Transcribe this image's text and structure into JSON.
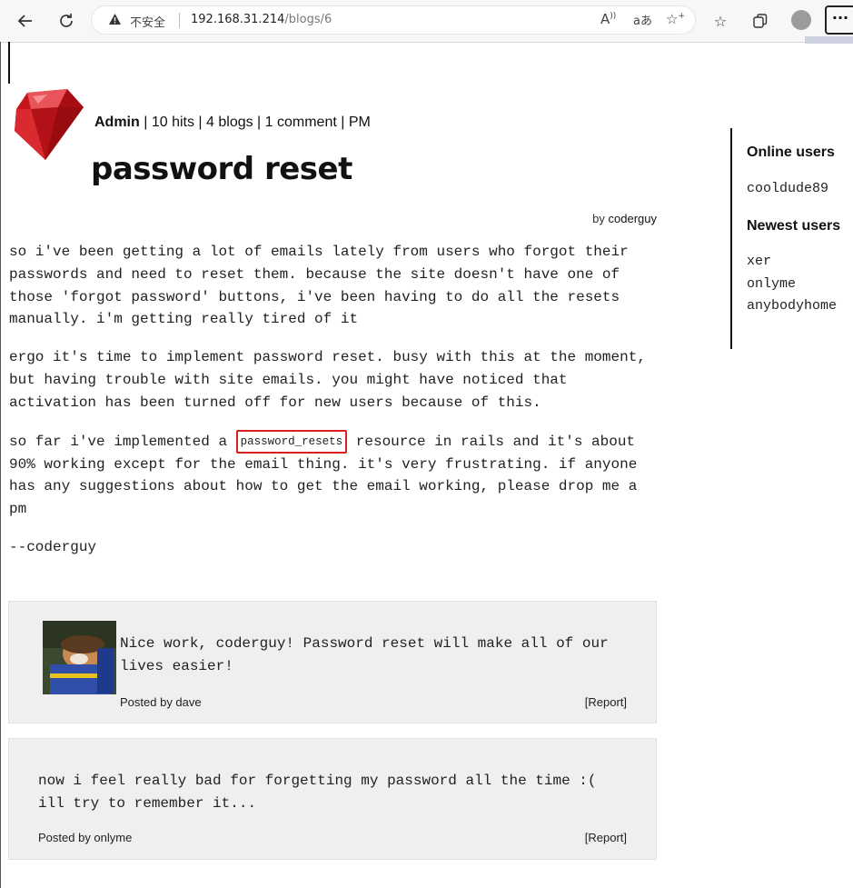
{
  "browser": {
    "security_label": "不安全",
    "url_host": "192.168.31.214",
    "url_path": "/blogs/6",
    "menu_label": "···"
  },
  "post": {
    "author_name": "Admin",
    "stats": " | 10 hits | 4 blogs | 1 comment | PM",
    "title": "password reset",
    "by_prefix": "by",
    "by_author": "coderguy",
    "para1": "so i've been getting a lot of emails lately from users who forgot their passwords and need to reset them. because the site doesn't have one of those 'forgot password' buttons, i've been having to do all the resets manually. i'm getting really tired of it",
    "para2": "ergo it's time to implement password reset. busy with this at the moment, but having trouble with site emails. you might have noticed that activation has been turned off for new users because of this.",
    "para3_before": "so far i've implemented a ",
    "para3_code": "password_resets",
    "para3_after": " resource in rails and it's about 90% working except for the email thing. it's very frustrating. if anyone has any suggestions about how to get the email working, please drop me a pm",
    "signature": "--coderguy"
  },
  "comments": [
    {
      "text": "Nice work, coderguy! Password reset will make all of our lives easier!",
      "posted_by": "Posted by dave",
      "report": "[Report]"
    },
    {
      "text": "now i feel really bad for forgetting my password all the time :( ill try to remember it...",
      "posted_by": "Posted by onlyme",
      "report": "[Report]"
    }
  ],
  "sidebar": {
    "online_heading": "Online users",
    "online_users": [
      "cooldude89"
    ],
    "newest_heading": "Newest users",
    "newest_users": [
      "xer",
      "onlyme",
      "anybodyhome"
    ]
  },
  "colors": {
    "highlight_border": "#d9201f",
    "comment_bg": "#efefef",
    "ruby_red": "#c8151b"
  },
  "icons": [
    "back-arrow-icon",
    "refresh-icon",
    "warning-icon",
    "read-aloud-icon",
    "translate-icon",
    "add-favorite-icon",
    "favorites-icon",
    "collections-icon",
    "profile-icon",
    "more-icon"
  ]
}
